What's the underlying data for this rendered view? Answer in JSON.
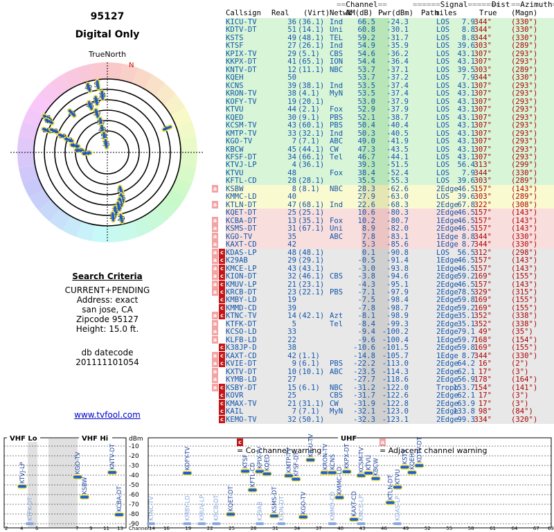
{
  "header": {
    "zipcode": "95127",
    "mode": "Digital Only",
    "true_north_label": "TrueNorth",
    "north_label": "N"
  },
  "criteria": {
    "title": "Search Criteria",
    "lines": [
      "CURRENT+PENDING",
      "Address: exact",
      "san jose, CA",
      "Zipcode 95127",
      "Height: 15.0 ft."
    ],
    "datecode_label": "db datecode",
    "datecode": "201111101054",
    "link": "www.tvfool.com"
  },
  "table": {
    "group_headers": {
      "channel": "Channel",
      "signal": "Signal",
      "dist": "Dist",
      "azimuth": "Azimuth"
    },
    "columns": [
      "Callsign",
      "Real",
      "(Virt)",
      "Netwk",
      "NM(dB)",
      "Pwr(dBm)",
      "Path",
      "miles",
      "True",
      "(Magn)"
    ],
    "rows": [
      [
        "",
        "KICU-TV",
        "36",
        "(36.1)",
        "Ind",
        "66.5",
        "-24.3",
        "LOS",
        "7.9",
        "344°",
        "(330°)",
        "green"
      ],
      [
        "",
        "KDTV-DT",
        "51",
        "(14.1)",
        "Uni",
        "60.8",
        "-30.1",
        "LOS",
        "8.8",
        "344°",
        "(330°)",
        "green"
      ],
      [
        "",
        "KSTS",
        "49",
        "(48.1)",
        "TEL",
        "59.2",
        "-31.7",
        "LOS",
        "8.8",
        "344°",
        "(330°)",
        "green"
      ],
      [
        "",
        "KTSF",
        "27",
        "(26.1)",
        "Ind",
        "54.9",
        "-35.9",
        "LOS",
        "39.6",
        "303°",
        "(289°)",
        "green"
      ],
      [
        "",
        "KPIX-TV",
        "29",
        "(5.1)",
        "CBS",
        "54.6",
        "-36.2",
        "LOS",
        "43.1",
        "307°",
        "(293°)",
        "green"
      ],
      [
        "",
        "KKPX-DT",
        "41",
        "(65.1)",
        "ION",
        "54.4",
        "-36.4",
        "LOS",
        "43.1",
        "307°",
        "(293°)",
        "green"
      ],
      [
        "",
        "KNTV-DT",
        "12",
        "(11.1)",
        "NBC",
        "53.7",
        "-37.1",
        "LOS",
        "39.5",
        "303°",
        "(289°)",
        "green"
      ],
      [
        "",
        "KQEH",
        "50",
        "",
        "",
        "53.7",
        "-37.2",
        "LOS",
        "7.9",
        "344°",
        "(330°)",
        "green"
      ],
      [
        "",
        "KCNS",
        "39",
        "(38.1)",
        "Ind",
        "53.5",
        "-37.4",
        "LOS",
        "43.1",
        "307°",
        "(293°)",
        "green"
      ],
      [
        "",
        "KRON-TV",
        "38",
        "(4.1)",
        "MyN",
        "53.5",
        "-37.4",
        "LOS",
        "43.1",
        "307°",
        "(293°)",
        "green"
      ],
      [
        "",
        "KOFY-TV",
        "19",
        "(20.1)",
        "",
        "53.0",
        "-37.9",
        "LOS",
        "43.1",
        "307°",
        "(293°)",
        "green"
      ],
      [
        "",
        "KTVU",
        "44",
        "(2.1)",
        "Fox",
        "52.9",
        "-37.9",
        "LOS",
        "43.1",
        "307°",
        "(293°)",
        "green"
      ],
      [
        "",
        "KQED",
        "30",
        "(9.1)",
        "PBS",
        "52.1",
        "-38.7",
        "LOS",
        "43.1",
        "307°",
        "(293°)",
        "green"
      ],
      [
        "",
        "KCSM-TV",
        "43",
        "(60.1)",
        "PBS",
        "50.4",
        "-40.4",
        "LOS",
        "43.1",
        "307°",
        "(293°)",
        "green"
      ],
      [
        "",
        "KMTP-TV",
        "33",
        "(32.1)",
        "Ind",
        "50.3",
        "-40.5",
        "LOS",
        "43.1",
        "307°",
        "(293°)",
        "green"
      ],
      [
        "",
        "KGO-TV",
        "7",
        "(7.1)",
        "ABC",
        "49.0",
        "-41.9",
        "LOS",
        "43.1",
        "307°",
        "(293°)",
        "green"
      ],
      [
        "",
        "KBCW",
        "45",
        "(44.1)",
        "CW",
        "47.3",
        "-43.5",
        "LOS",
        "43.1",
        "307°",
        "(293°)",
        "green"
      ],
      [
        "",
        "KFSF-DT",
        "34",
        "(66.1)",
        "Tel",
        "46.7",
        "-44.1",
        "LOS",
        "43.1",
        "307°",
        "(293°)",
        "green"
      ],
      [
        "",
        "KTVJ-LP",
        "4",
        "(36.1)",
        "",
        "39.3",
        "-51.5",
        "LOS",
        "56.4",
        "313°",
        "(299°)",
        "green"
      ],
      [
        "",
        "KTVU",
        "48",
        "",
        "Fox",
        "38.4",
        "-52.4",
        "LOS",
        "7.9",
        "344°",
        "(330°)",
        "green"
      ],
      [
        "",
        "KFTL-CD",
        "28",
        "(28.1)",
        "",
        "35.5",
        "-55.3",
        "LOS",
        "39.6",
        "303°",
        "(289°)",
        "green"
      ],
      [
        "a",
        "KSBW",
        "8",
        "(8.1)",
        "NBC",
        "28.3",
        "-62.6",
        "2Edge",
        "46.5",
        "157°",
        "(143°)",
        "yellow"
      ],
      [
        "",
        "KMMC-LD",
        "40",
        "",
        "",
        "27.9",
        "-63.0",
        "LOS",
        "39.6",
        "303°",
        "(289°)",
        "yellow"
      ],
      [
        "a",
        "KTLN-DT",
        "47",
        "(68.1)",
        "Ind",
        "22.6",
        "-68.3",
        "2Edge",
        "67.8",
        "322°",
        "(308°)",
        "yellow"
      ],
      [
        "",
        "KQET-DT",
        "25",
        "(25.1)",
        "",
        "10.6",
        "-80.3",
        "2Edge",
        "46.5",
        "157°",
        "(143°)",
        "pink"
      ],
      [
        "a",
        "KCBA-DT",
        "13",
        "(35.1)",
        "Fox",
        "10.2",
        "-80.7",
        "1Edge",
        "46.5",
        "157°",
        "(143°)",
        "pink"
      ],
      [
        "a",
        "KSMS-DT",
        "31",
        "(67.1)",
        "Uni",
        "8.9",
        "-82.0",
        "2Edge",
        "46.5",
        "157°",
        "(143°)",
        "pink"
      ],
      [
        "a",
        "KGO-TV",
        "35",
        "",
        "ABC",
        "7.8",
        "-83.1",
        "1Edge",
        "8.8",
        "344°",
        "(330°)",
        "pink"
      ],
      [
        "a",
        "KAXT-CD",
        "42",
        "",
        "",
        "5.3",
        "-85.6",
        "1Edge",
        "8.7",
        "344°",
        "(330°)",
        "pink"
      ],
      [
        "ac",
        "KDAS-LP",
        "48",
        "(48.1)",
        "",
        "0.1",
        "-90.8",
        "LOS",
        "56.5",
        "312°",
        "(298°)",
        "gray"
      ],
      [
        "ac",
        "K29AB",
        "29",
        "(29.1)",
        "",
        "-0.5",
        "-91.4",
        "1Edge",
        "46.5",
        "157°",
        "(143°)",
        "gray"
      ],
      [
        "ac",
        "KMCE-LP",
        "43",
        "(43.1)",
        "",
        "-3.0",
        "-93.8",
        "1Edge",
        "46.5",
        "157°",
        "(143°)",
        "gray"
      ],
      [
        "ac",
        "KION-DT",
        "32",
        "(46.1)",
        "CBS",
        "-3.8",
        "-94.6",
        "2Edge",
        "59.2",
        "169°",
        "(155°)",
        "gray"
      ],
      [
        "ac",
        "KMUV-LP",
        "21",
        "(23.1)",
        "",
        "-4.3",
        "-95.1",
        "2Edge",
        "46.5",
        "157°",
        "(143°)",
        "gray"
      ],
      [
        "ac",
        "KRCB-DT",
        "23",
        "(22.1)",
        "PBS",
        "-7.1",
        "-97.9",
        "2Edge",
        "78.5",
        "329°",
        "(315°)",
        "gray"
      ],
      [
        "c",
        "KMBY-LD",
        "19",
        "",
        "",
        "-7.5",
        "-98.4",
        "2Edge",
        "59.8",
        "169°",
        "(155°)",
        "gray"
      ],
      [
        "c",
        "KMMD-CD",
        "39",
        "",
        "",
        "-7.8",
        "-98.7",
        "2Edge",
        "59.2",
        "169°",
        "(155°)",
        "gray"
      ],
      [
        "ac",
        "KTNC-TV",
        "14",
        "(42.1)",
        "Azt",
        "-8.1",
        "-98.9",
        "2Edge",
        "35.1",
        "352°",
        "(338°)",
        "gray"
      ],
      [
        "a",
        "KTFK-DT",
        "5",
        "",
        "Tel",
        "-8.4",
        "-99.3",
        "2Edge",
        "35.1",
        "352°",
        "(338°)",
        "gray"
      ],
      [
        "a",
        "KCSO-LD",
        "33",
        "",
        "",
        "-9.4",
        "-100.2",
        "2Edge",
        "79.1",
        "49°",
        "(35°)",
        "gray"
      ],
      [
        "a",
        "KLFB-LD",
        "22",
        "",
        "",
        "-9.6",
        "-100.4",
        "1Edge",
        "59.7",
        "168°",
        "(154°)",
        "gray"
      ],
      [
        "c",
        "K38JP-D",
        "38",
        "",
        "",
        "-10.6",
        "-101.5",
        "2Edge",
        "59.8",
        "169°",
        "(155°)",
        "gray"
      ],
      [
        "ac",
        "KAXT-CD",
        "42",
        "(1.1)",
        "",
        "-14.8",
        "-105.7",
        "1Edge",
        "8.7",
        "344°",
        "(330°)",
        "gray"
      ],
      [
        "ac",
        "KVIE-DT",
        "9",
        "(6.1)",
        "PBS",
        "-22.2",
        "-113.0",
        "2Edge",
        "64.2",
        "16°",
        "(2°)",
        "gray"
      ],
      [
        "a",
        "KXTV-DT",
        "10",
        "(10.1)",
        "ABC",
        "-23.5",
        "-114.3",
        "2Edge",
        "62.1",
        "17°",
        "(3°)",
        "gray"
      ],
      [
        "a",
        "KYMB-LD",
        "27",
        "",
        "",
        "-27.7",
        "-118.6",
        "2Edge",
        "56.9",
        "178°",
        "(164°)",
        "gray"
      ],
      [
        "ac",
        "KSBY-DT",
        "15",
        "(6.1)",
        "NBC",
        "-31.2",
        "-122.0",
        "Tropo",
        "153.7",
        "154°",
        "(141°)",
        "gray"
      ],
      [
        "c",
        "KOVR",
        "25",
        "",
        "CBS",
        "-31.7",
        "-122.6",
        "2Edge",
        "62.1",
        "17°",
        "(3°)",
        "gray"
      ],
      [
        "c",
        "KMAX-TV",
        "21",
        "(31.1)",
        "CW",
        "-31.9",
        "-122.8",
        "2Edge",
        "63.9",
        "17°",
        "(3°)",
        "gray"
      ],
      [
        "c",
        "KAIL",
        "7",
        "(7.1)",
        "MyN",
        "-32.1",
        "-123.0",
        "2Edge",
        "133.8",
        "98°",
        "(84°)",
        "gray"
      ],
      [
        "c",
        "KEMO-TV",
        "32",
        "(50.1)",
        "",
        "-32.3",
        "-123.1",
        "2Edge",
        "99.3",
        "334°",
        "(320°)",
        "gray"
      ]
    ]
  },
  "legend": {
    "cochannel_icon": "c",
    "cochannel_label": "= Co-channel warning",
    "adjacent_icon": "a",
    "adjacent_label": "= Adjacent channel warning"
  },
  "bands": {
    "vhf_lo": "VHF Lo",
    "vhf_hi": "VHF Hi",
    "uhf": "UHF",
    "dbm_unit": "dBm",
    "channel_label": "Channel"
  },
  "chart_data": {
    "type": "scatter",
    "ylabel": "dBm",
    "ylim": [
      -90,
      -10
    ],
    "yticks": [
      -10,
      -20,
      -30,
      -40,
      -50,
      -60,
      -70,
      -80,
      -90
    ],
    "xticks": [
      "2",
      "4",
      "6",
      "7",
      "9",
      "11",
      "13",
      "14",
      "16",
      "19",
      "22",
      "25",
      "28",
      "31",
      "34",
      "37",
      "40",
      "43",
      "46",
      "49",
      "52",
      "55",
      "58",
      "61",
      "64",
      "67",
      "69"
    ],
    "vhf_lo_channels": [
      2,
      6
    ],
    "vhf_hi_channels": [
      7,
      13
    ],
    "uhf_channels": [
      14,
      69
    ],
    "points": [
      {
        "ch": 4,
        "dbm": -51.5,
        "name": "KTVJ-LP",
        "strong": true
      },
      {
        "ch": 5,
        "dbm": -99.3,
        "name": "KTFK-DT",
        "strong": false
      },
      {
        "ch": 7,
        "dbm": -41.9,
        "name": "KGO-TV",
        "strong": true
      },
      {
        "ch": 8,
        "dbm": -62.6,
        "name": "KSBW",
        "strong": true
      },
      {
        "ch": 12,
        "dbm": -37.1,
        "name": "KNTV-DT",
        "strong": true
      },
      {
        "ch": 13,
        "dbm": -80.7,
        "name": "KCBA-DT",
        "strong": true
      },
      {
        "ch": 14,
        "dbm": -98.9,
        "name": "KTNC-TV",
        "strong": false
      },
      {
        "ch": 19,
        "dbm": -37.9,
        "name": "KOFY-TV",
        "strong": true
      },
      {
        "ch": 19,
        "dbm": -98.4,
        "name": "KMBY-LD",
        "strong": false
      },
      {
        "ch": 21,
        "dbm": -95.1,
        "name": "KMUV-LP",
        "strong": false
      },
      {
        "ch": 23,
        "dbm": -97.9,
        "name": "KRCB-DT",
        "strong": false
      },
      {
        "ch": 25,
        "dbm": -80.3,
        "name": "KQET-DT",
        "strong": true
      },
      {
        "ch": 27,
        "dbm": -35.9,
        "name": "KTSF",
        "strong": true
      },
      {
        "ch": 28,
        "dbm": -55.3,
        "name": "KFTL-CD",
        "strong": true
      },
      {
        "ch": 29,
        "dbm": -36.2,
        "name": "KPIX-TV",
        "strong": true
      },
      {
        "ch": 29,
        "dbm": -91.4,
        "name": "K29AB",
        "strong": false
      },
      {
        "ch": 30,
        "dbm": -38.7,
        "name": "KQED",
        "strong": true
      },
      {
        "ch": 31,
        "dbm": -82.0,
        "name": "KSMS-DT",
        "strong": true
      },
      {
        "ch": 32,
        "dbm": -94.6,
        "name": "KION-DT",
        "strong": false
      },
      {
        "ch": 33,
        "dbm": -40.5,
        "name": "KMTP-TV",
        "strong": true
      },
      {
        "ch": 34,
        "dbm": -44.1,
        "name": "KFSF-DT",
        "strong": true
      },
      {
        "ch": 35,
        "dbm": -83.1,
        "name": "KGO-TV",
        "strong": true
      },
      {
        "ch": 36,
        "dbm": -24.3,
        "name": "KICU-TV",
        "strong": true
      },
      {
        "ch": 38,
        "dbm": -37.4,
        "name": "KRON-TV",
        "strong": true
      },
      {
        "ch": 39,
        "dbm": -37.4,
        "name": "KCNS",
        "strong": true
      },
      {
        "ch": 39,
        "dbm": -98.7,
        "name": "KMMD-CD",
        "strong": false
      },
      {
        "ch": 40,
        "dbm": -63.0,
        "name": "KMMC-LD",
        "strong": true
      },
      {
        "ch": 41,
        "dbm": -36.4,
        "name": "KKPX-DT",
        "strong": true
      },
      {
        "ch": 42,
        "dbm": -85.6,
        "name": "KAXT-CD",
        "strong": true
      },
      {
        "ch": 43,
        "dbm": -40.4,
        "name": "KCSM-TV",
        "strong": true
      },
      {
        "ch": 43,
        "dbm": -93.8,
        "name": "KMCE-LP",
        "strong": false
      },
      {
        "ch": 44,
        "dbm": -37.9,
        "name": "KTVU",
        "strong": true
      },
      {
        "ch": 45,
        "dbm": -43.5,
        "name": "KBCW",
        "strong": true
      },
      {
        "ch": 47,
        "dbm": -68.3,
        "name": "KTLN-DT",
        "strong": true
      },
      {
        "ch": 48,
        "dbm": -52.4,
        "name": "KTVU",
        "strong": true
      },
      {
        "ch": 48,
        "dbm": -90.8,
        "name": "KDAS-LP",
        "strong": false
      },
      {
        "ch": 49,
        "dbm": -31.7,
        "name": "KSTS",
        "strong": true
      },
      {
        "ch": 50,
        "dbm": -37.2,
        "name": "KQEH",
        "strong": true
      },
      {
        "ch": 51,
        "dbm": -30.1,
        "name": "KDTV-DT",
        "strong": true
      }
    ]
  },
  "radar_data": {
    "rings": 6,
    "stations": [
      {
        "ch": "42",
        "az": 344,
        "r": 0.92
      },
      {
        "ch": "5",
        "az": 352,
        "r": 0.93
      },
      {
        "ch": "14",
        "az": 355,
        "r": 0.78
      },
      {
        "ch": "36",
        "az": 348,
        "r": 0.72
      },
      {
        "ch": "45",
        "az": 340,
        "r": 0.68
      },
      {
        "ch": "23",
        "az": 318,
        "r": 0.72
      },
      {
        "ch": "30",
        "az": 345,
        "r": 0.55
      },
      {
        "ch": "50",
        "az": 348,
        "r": 0.42
      },
      {
        "ch": "49",
        "az": 348,
        "r": 0.32
      },
      {
        "ch": "51",
        "az": 350,
        "r": 0.22
      },
      {
        "ch": "36",
        "az": 352,
        "r": 0.12
      },
      {
        "ch": "3",
        "az": 68,
        "r": 0.88
      },
      {
        "ch": "48",
        "az": 300,
        "r": 0.95
      },
      {
        "ch": "44",
        "az": 298,
        "r": 0.9
      },
      {
        "ch": "28",
        "az": 290,
        "r": 0.88
      },
      {
        "ch": "38",
        "az": 292,
        "r": 0.78
      },
      {
        "ch": "39",
        "az": 290,
        "r": 0.65
      },
      {
        "ch": "12",
        "az": 288,
        "r": 0.55
      },
      {
        "ch": "41",
        "az": 282,
        "r": 0.45
      },
      {
        "ch": "29",
        "az": 274,
        "r": 0.38
      },
      {
        "ch": "27",
        "az": 268,
        "r": 0.28
      },
      {
        "ch": "8",
        "az": 160,
        "r": 0.55
      },
      {
        "ch": "25",
        "az": 162,
        "r": 0.65
      },
      {
        "ch": "13",
        "az": 165,
        "r": 0.7
      },
      {
        "ch": "31",
        "az": 168,
        "r": 0.75
      },
      {
        "ch": "32",
        "az": 172,
        "r": 0.8
      },
      {
        "ch": "19",
        "az": 175,
        "r": 0.88
      },
      {
        "ch": "29",
        "az": 168,
        "r": 0.92
      }
    ]
  }
}
